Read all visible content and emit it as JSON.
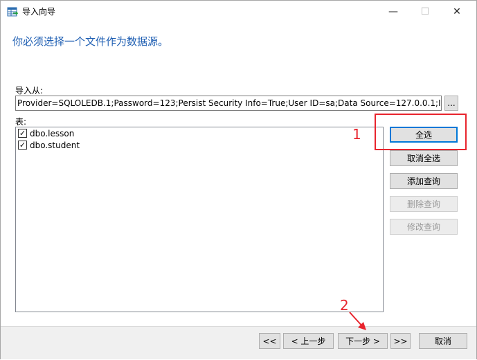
{
  "window": {
    "title": "导入向导",
    "minimize": "—",
    "maximize": "☐",
    "close": "✕"
  },
  "heading": "你必须选择一个文件作为数据源。",
  "import_from": {
    "label": "导入从:",
    "value": "Provider=SQLOLEDB.1;Password=123;Persist Security Info=True;User ID=sa;Data Source=127.0.0.1;Initial",
    "browse_label": "..."
  },
  "tables": {
    "label": "表:",
    "items": [
      {
        "name": "dbo.lesson",
        "checked": true
      },
      {
        "name": "dbo.student",
        "checked": true
      }
    ]
  },
  "side_buttons": {
    "select_all": "全选",
    "deselect_all": "取消全选",
    "add_query": "添加查询",
    "delete_query": "删除查询",
    "edit_query": "修改查询"
  },
  "footer": {
    "first": "<<",
    "prev": "< 上一步",
    "next": "下一步 >",
    "last": ">>",
    "cancel": "取消"
  },
  "annotations": {
    "marker_1": "1",
    "marker_2": "2",
    "color": "#e8242d"
  },
  "colors": {
    "heading": "#1f5fb3",
    "default_button_border": "#0078d7"
  }
}
